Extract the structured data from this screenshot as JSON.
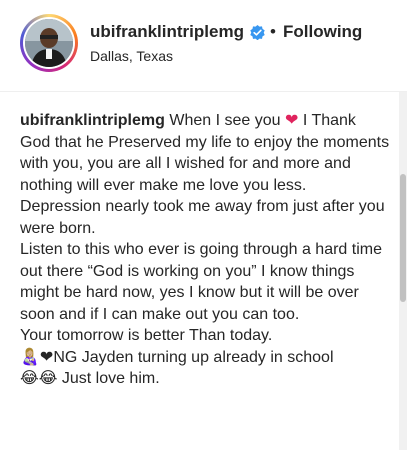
{
  "header": {
    "username": "ubifranklintriplemg",
    "separator": "•",
    "follow_status": "Following",
    "location": "Dallas, Texas",
    "verified": true
  },
  "caption": {
    "username": "ubifranklintriplemg",
    "line1_text": "When I see you",
    "line1_emoji": "❤",
    "line1_rest": "I Thank God that he Preserved my life to enjoy the moments with you, you are all I wished for and more and nothing will ever make me love you less.",
    "para2": "Depression nearly took me away from just after you were born.",
    "para3": "Listen to this who ever is going through a hard time out there “God is working on you” I know things might be hard now, yes I know but it will be over soon and if I can make out you can too.",
    "para4": "Your tomorrow is better Than today.",
    "para5_emoji": "👩🏼‍🍼❤",
    "para5_text": "NG Jayden turning up already in school",
    "para6_emoji": "😂😂",
    "para6_text": "Just love him."
  },
  "colors": {
    "text": "#262626",
    "verified_blue": "#3897f0",
    "heart_red": "#e0245e",
    "border": "#efefef"
  },
  "icons": {
    "verified": "verified-badge-icon"
  }
}
